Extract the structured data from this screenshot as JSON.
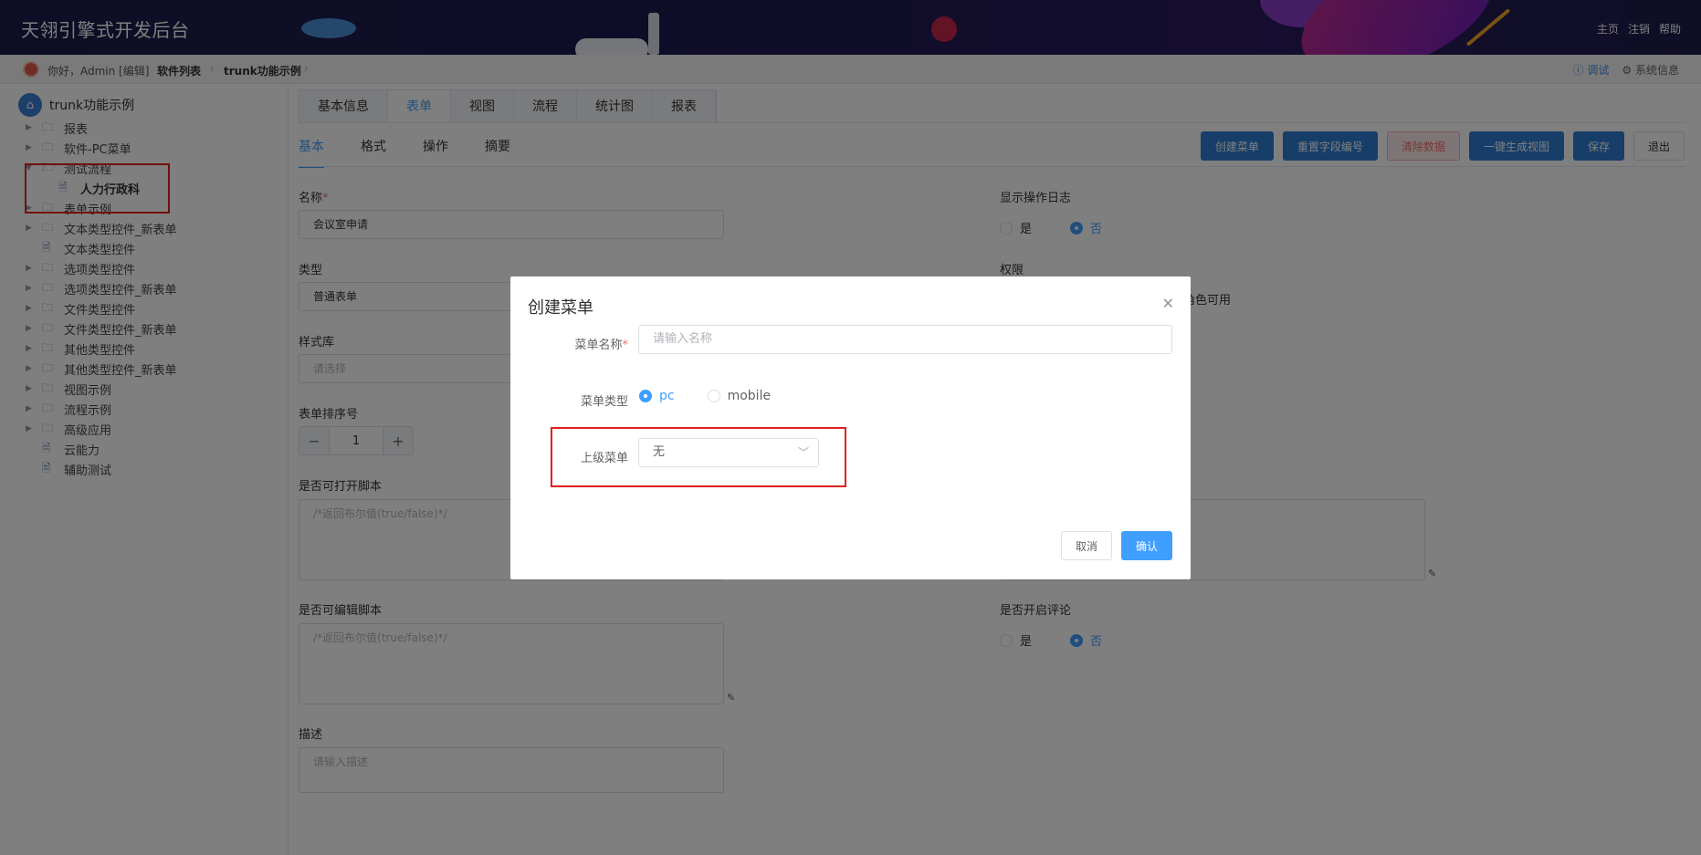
{
  "header": {
    "app_title": "天翎引擎式开发后台",
    "nav": [
      "主页",
      "注销",
      "帮助"
    ]
  },
  "crumbbar": {
    "greeting": "你好，Admin [编辑]",
    "crumbs": [
      "软件列表",
      "trunk功能示例"
    ],
    "debug": "调试",
    "system_info": "系统信息"
  },
  "sidebar": {
    "root": "trunk功能示例",
    "items": [
      {
        "label": "报表",
        "type": "folder",
        "expandable": true
      },
      {
        "label": "软件-PC菜单",
        "type": "folder",
        "expandable": true
      },
      {
        "label": "测试流程",
        "type": "folder-open",
        "expandable": true
      },
      {
        "label": "人力行政科",
        "type": "file",
        "child": true
      },
      {
        "label": "表单示例",
        "type": "folder",
        "expandable": true
      },
      {
        "label": "文本类型控件_新表单",
        "type": "folder",
        "expandable": true
      },
      {
        "label": "文本类型控件",
        "type": "file"
      },
      {
        "label": "选项类型控件",
        "type": "folder",
        "expandable": true
      },
      {
        "label": "选项类型控件_新表单",
        "type": "folder",
        "expandable": true
      },
      {
        "label": "文件类型控件",
        "type": "folder",
        "expandable": true
      },
      {
        "label": "文件类型控件_新表单",
        "type": "folder",
        "expandable": true
      },
      {
        "label": "其他类型控件",
        "type": "folder",
        "expandable": true
      },
      {
        "label": "其他类型控件_新表单",
        "type": "folder",
        "expandable": true
      },
      {
        "label": "视图示例",
        "type": "folder",
        "expandable": true
      },
      {
        "label": "流程示例",
        "type": "folder",
        "expandable": true
      },
      {
        "label": "高级应用",
        "type": "folder",
        "expandable": true
      },
      {
        "label": "云能力",
        "type": "file"
      },
      {
        "label": "辅助测试",
        "type": "file"
      }
    ]
  },
  "main": {
    "top_tabs": [
      "基本信息",
      "表单",
      "视图",
      "流程",
      "统计图",
      "报表"
    ],
    "top_tab_active": "表单",
    "sub_tabs": [
      "基本",
      "格式",
      "操作",
      "摘要"
    ],
    "sub_tab_active": "基本",
    "actions": {
      "create_menu": "创建菜单",
      "reset_field": "重置字段编号",
      "clear_data": "清除数据",
      "gen_view": "一键生成视图",
      "save": "保存",
      "exit": "退出"
    },
    "form": {
      "name_label": "名称",
      "name_value": "会议室申请",
      "type_label": "类型",
      "type_value": "普通表单",
      "style_label": "样式库",
      "style_placeholder": "请选择",
      "order_label": "表单排序号",
      "order_value": "1",
      "open_script_label": "是否可打开脚本",
      "open_script_placeholder": "/*返回布尔值(true/false)*/",
      "edit_script_label": "是否可编辑脚本",
      "edit_script_placeholder": "/*返回布尔值(true/false)*/",
      "desc_label": "描述",
      "desc_placeholder": "请输入描述",
      "log_label": "显示操作日志",
      "yes": "是",
      "no": "否",
      "perm_label": "权限",
      "perm_partial": "角色可用",
      "comment_label": "是否开启评论"
    }
  },
  "dialog": {
    "title": "创建菜单",
    "name_label": "菜单名称",
    "name_placeholder": "请输入名称",
    "type_label": "菜单类型",
    "type_pc": "pc",
    "type_mobile": "mobile",
    "parent_label": "上级菜单",
    "parent_value": "无",
    "cancel": "取消",
    "confirm": "确认"
  },
  "colors": {
    "accent": "#409eff",
    "primary_button": "#2d7dd2",
    "highlight_box": "#e02020"
  }
}
